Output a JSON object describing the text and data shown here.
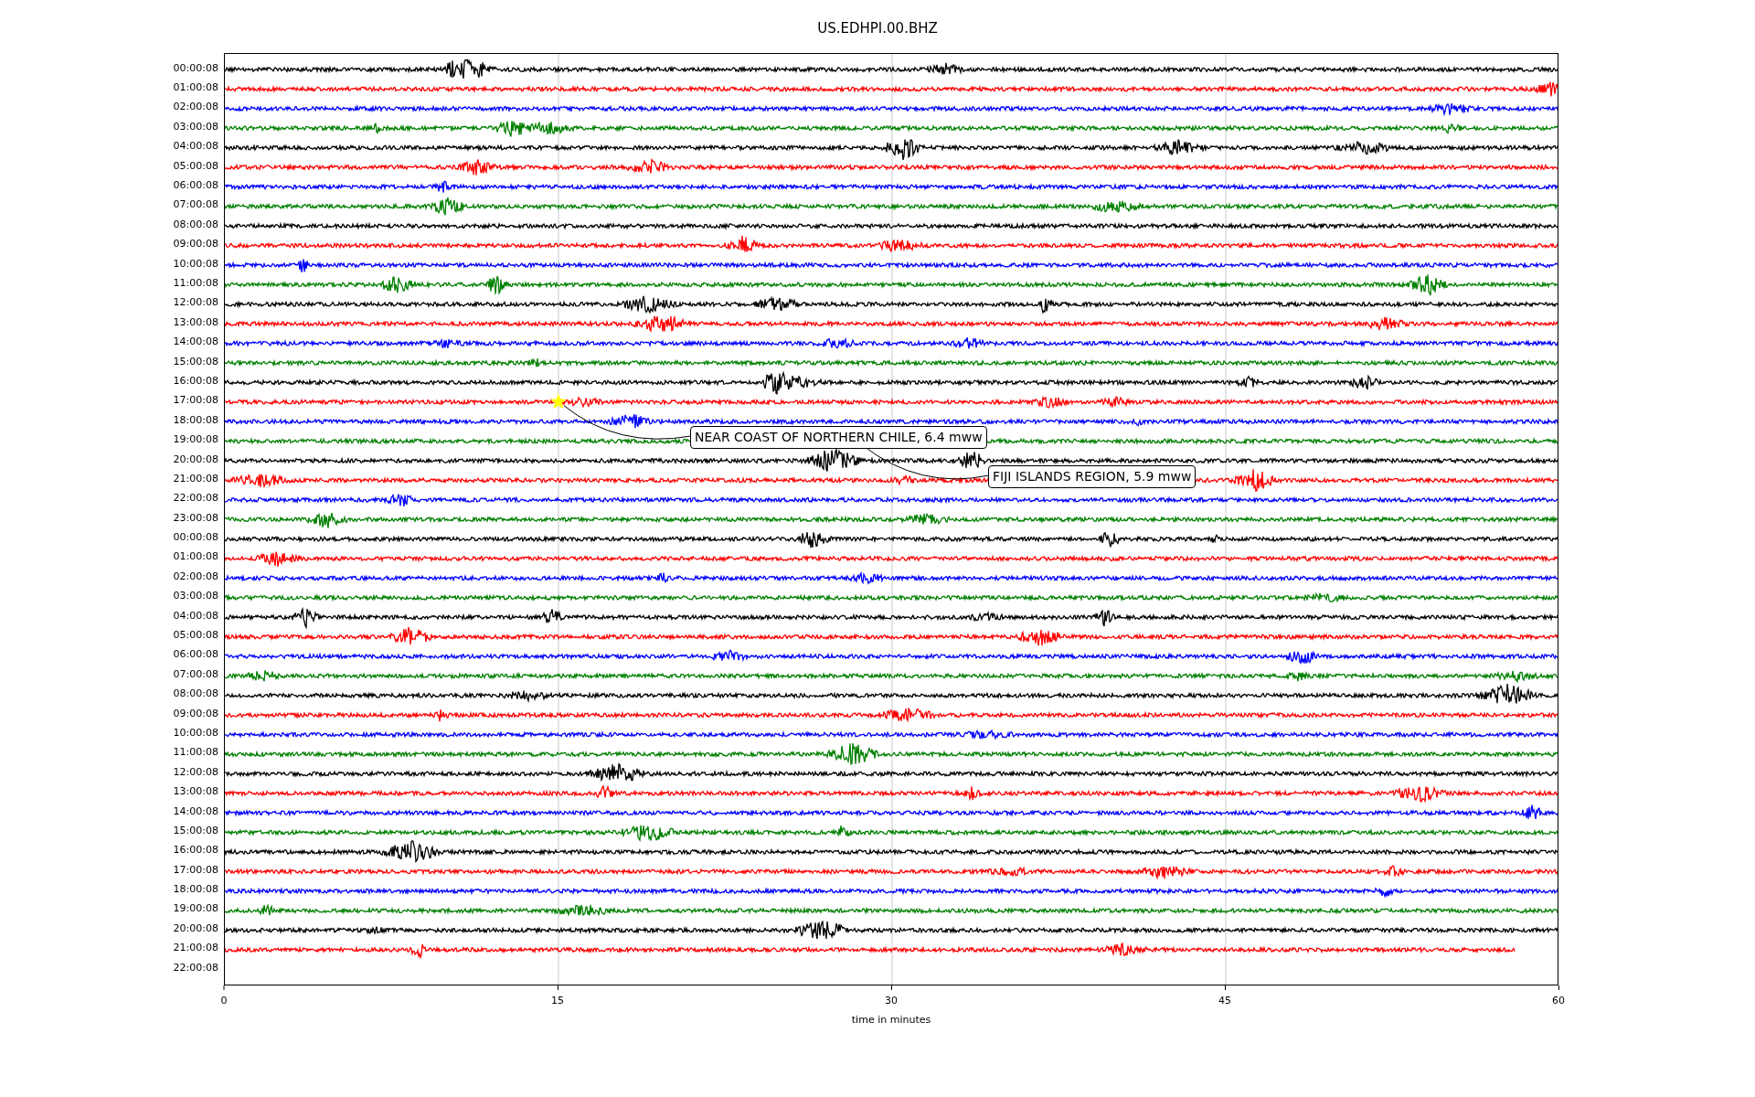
{
  "title": "US.EDHPI.00.BHZ",
  "xlabel": "time in minutes",
  "xticks": [
    "0",
    "15",
    "30",
    "45",
    "60"
  ],
  "rows": [
    {
      "label": "00:00:08",
      "color": "#000000",
      "has_trace": true,
      "cut_short": false
    },
    {
      "label": "01:00:08",
      "color": "#ff0000",
      "has_trace": true,
      "cut_short": false
    },
    {
      "label": "02:00:08",
      "color": "#0000ff",
      "has_trace": true,
      "cut_short": false
    },
    {
      "label": "03:00:08",
      "color": "#008000",
      "has_trace": true,
      "cut_short": false
    },
    {
      "label": "04:00:08",
      "color": "#000000",
      "has_trace": true,
      "cut_short": false
    },
    {
      "label": "05:00:08",
      "color": "#ff0000",
      "has_trace": true,
      "cut_short": false
    },
    {
      "label": "06:00:08",
      "color": "#0000ff",
      "has_trace": true,
      "cut_short": false
    },
    {
      "label": "07:00:08",
      "color": "#008000",
      "has_trace": true,
      "cut_short": false
    },
    {
      "label": "08:00:08",
      "color": "#000000",
      "has_trace": true,
      "cut_short": false
    },
    {
      "label": "09:00:08",
      "color": "#ff0000",
      "has_trace": true,
      "cut_short": false
    },
    {
      "label": "10:00:08",
      "color": "#0000ff",
      "has_trace": true,
      "cut_short": false
    },
    {
      "label": "11:00:08",
      "color": "#008000",
      "has_trace": true,
      "cut_short": false
    },
    {
      "label": "12:00:08",
      "color": "#000000",
      "has_trace": true,
      "cut_short": false
    },
    {
      "label": "13:00:08",
      "color": "#ff0000",
      "has_trace": true,
      "cut_short": false
    },
    {
      "label": "14:00:08",
      "color": "#0000ff",
      "has_trace": true,
      "cut_short": false
    },
    {
      "label": "15:00:08",
      "color": "#008000",
      "has_trace": true,
      "cut_short": false
    },
    {
      "label": "16:00:08",
      "color": "#000000",
      "has_trace": true,
      "cut_short": false
    },
    {
      "label": "17:00:08",
      "color": "#ff0000",
      "has_trace": true,
      "cut_short": false
    },
    {
      "label": "18:00:08",
      "color": "#0000ff",
      "has_trace": true,
      "cut_short": false
    },
    {
      "label": "19:00:08",
      "color": "#008000",
      "has_trace": true,
      "cut_short": false
    },
    {
      "label": "20:00:08",
      "color": "#000000",
      "has_trace": true,
      "cut_short": false
    },
    {
      "label": "21:00:08",
      "color": "#ff0000",
      "has_trace": true,
      "cut_short": false
    },
    {
      "label": "22:00:08",
      "color": "#0000ff",
      "has_trace": true,
      "cut_short": false
    },
    {
      "label": "23:00:08",
      "color": "#008000",
      "has_trace": true,
      "cut_short": false
    },
    {
      "label": "00:00:08",
      "color": "#000000",
      "has_trace": true,
      "cut_short": false
    },
    {
      "label": "01:00:08",
      "color": "#ff0000",
      "has_trace": true,
      "cut_short": false
    },
    {
      "label": "02:00:08",
      "color": "#0000ff",
      "has_trace": true,
      "cut_short": false
    },
    {
      "label": "03:00:08",
      "color": "#008000",
      "has_trace": true,
      "cut_short": false
    },
    {
      "label": "04:00:08",
      "color": "#000000",
      "has_trace": true,
      "cut_short": false
    },
    {
      "label": "05:00:08",
      "color": "#ff0000",
      "has_trace": true,
      "cut_short": false
    },
    {
      "label": "06:00:08",
      "color": "#0000ff",
      "has_trace": true,
      "cut_short": false
    },
    {
      "label": "07:00:08",
      "color": "#008000",
      "has_trace": true,
      "cut_short": false
    },
    {
      "label": "08:00:08",
      "color": "#000000",
      "has_trace": true,
      "cut_short": false
    },
    {
      "label": "09:00:08",
      "color": "#ff0000",
      "has_trace": true,
      "cut_short": false
    },
    {
      "label": "10:00:08",
      "color": "#0000ff",
      "has_trace": true,
      "cut_short": false
    },
    {
      "label": "11:00:08",
      "color": "#008000",
      "has_trace": true,
      "cut_short": false
    },
    {
      "label": "12:00:08",
      "color": "#000000",
      "has_trace": true,
      "cut_short": false
    },
    {
      "label": "13:00:08",
      "color": "#ff0000",
      "has_trace": true,
      "cut_short": false
    },
    {
      "label": "14:00:08",
      "color": "#0000ff",
      "has_trace": true,
      "cut_short": false
    },
    {
      "label": "15:00:08",
      "color": "#008000",
      "has_trace": true,
      "cut_short": false
    },
    {
      "label": "16:00:08",
      "color": "#000000",
      "has_trace": true,
      "cut_short": false
    },
    {
      "label": "17:00:08",
      "color": "#ff0000",
      "has_trace": true,
      "cut_short": false
    },
    {
      "label": "18:00:08",
      "color": "#0000ff",
      "has_trace": true,
      "cut_short": false
    },
    {
      "label": "19:00:08",
      "color": "#008000",
      "has_trace": true,
      "cut_short": false
    },
    {
      "label": "20:00:08",
      "color": "#000000",
      "has_trace": true,
      "cut_short": false
    },
    {
      "label": "21:00:08",
      "color": "#ff0000",
      "has_trace": true,
      "cut_short": true
    },
    {
      "label": "22:00:08",
      "has_trace": false
    }
  ],
  "annotations": [
    {
      "text": "NEAR COAST OF NORTHERN CHILE, 6.4 mww"
    },
    {
      "text": "FIJI ISLANDS REGION, 5.9 mww"
    }
  ]
}
